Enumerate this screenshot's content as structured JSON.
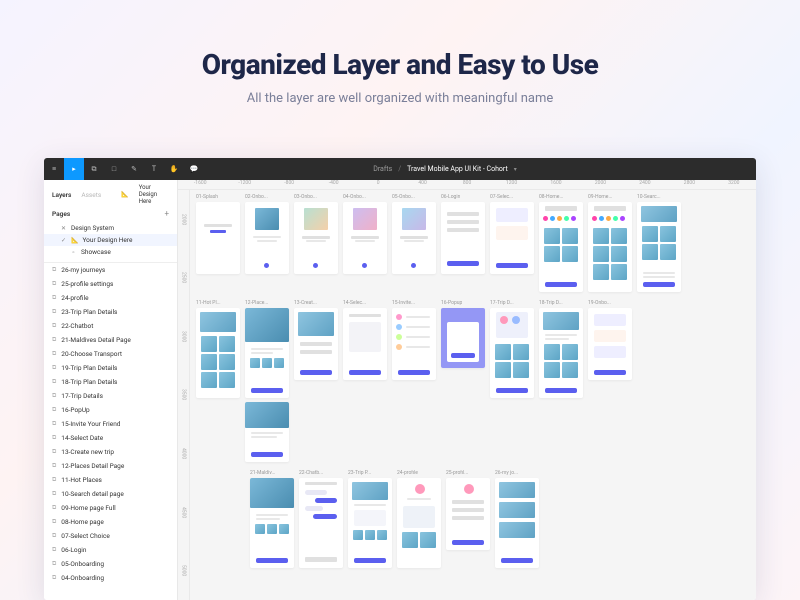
{
  "hero": {
    "title": "Organized Layer and Easy to Use",
    "subtitle": "All the layer are well organized with meaningful name"
  },
  "toolbar": {
    "drafts": "Drafts",
    "title": "Travel Mobile App UI Kit - Cohort"
  },
  "sidebar": {
    "tab_layers": "Layers",
    "tab_assets": "Assets",
    "your_design": "Your Design Here",
    "pages_label": "Pages",
    "tree": {
      "design_system": "Design System",
      "your_design_here": "Your Design Here",
      "showcase": "Showcase"
    },
    "items": [
      "26-my journeys",
      "25-profile settings",
      "24-profile",
      "23-Trip Plan Details",
      "22-Chatbot",
      "21-Maldives Detail Page",
      "20-Choose Transport",
      "19-Trip Plan Details",
      "18-Trip Plan Details",
      "17-Trip Details",
      "16-PopUp",
      "15-Invite Your Friend",
      "14-Select Date",
      "13-Create new trip",
      "12-Places Detail Page",
      "11-Hot Places",
      "10-Search detail page",
      "09-Home page Full",
      "08-Home page",
      "07-Select Choice",
      "06-Login",
      "05-Onboarding",
      "04-Onboarding"
    ]
  },
  "ruler_h": [
    "-1600",
    "-1200",
    "-800",
    "-400",
    "0",
    "400",
    "800",
    "1200",
    "1600",
    "2000",
    "2400",
    "2800",
    "3200"
  ],
  "ruler_v": [
    "2000",
    "2500",
    "3000",
    "3500",
    "4000",
    "4500",
    "5000"
  ],
  "frames": {
    "row1": [
      "01-Splash",
      "02-Onbo...",
      "03-Onbo...",
      "04-Onbo...",
      "05-Onbo...",
      "06-Login",
      "07-Selec...",
      "08-Home...",
      "09-Home...",
      "10-Searc..."
    ],
    "row2": [
      "11-Hot Pl...",
      "12-Place...",
      "13-Creat...",
      "14-Selec...",
      "15-Invite...",
      "16-Popup",
      "17-Trip D...",
      "18-Trip D...",
      "19-Onbo..."
    ],
    "row3": [
      "21-Maldiv...",
      "22-Chatb...",
      "23-Trip P...",
      "24-profile",
      "25-profil...",
      "26-my jo..."
    ]
  }
}
